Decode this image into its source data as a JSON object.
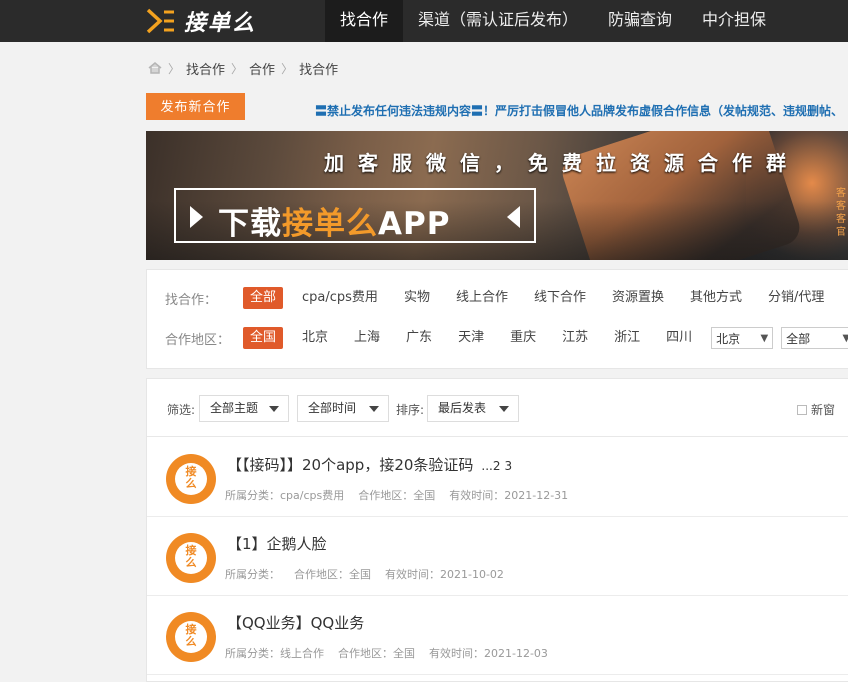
{
  "header": {
    "logo_text": "接单么",
    "nav": [
      "找合作",
      "渠道（需认证后发布）",
      "防骗查询",
      "中介担保"
    ]
  },
  "breadcrumb": [
    "找合作",
    "合作",
    "找合作"
  ],
  "publish_label": "发布新合作",
  "notice": "〓禁止发布任何违法违规内容〓！严厉打击假冒他人品牌发布虚假合作信息（发帖规范、违规删帖、",
  "banner": {
    "slogan": "加客服微信，免费拉资源合作群",
    "app_prefix": "下载",
    "app_highlight": "接单么",
    "app_suffix": "APP",
    "side": "客客客官"
  },
  "filters": {
    "type_label": "找合作：",
    "types": [
      "全部",
      "cpa/cps费用",
      "实物",
      "线上合作",
      "线下合作",
      "资源置换",
      "其他方式",
      "分销/代理"
    ],
    "region_label": "合作地区：",
    "regions": [
      "全国",
      "北京",
      "上海",
      "广东",
      "天津",
      "重庆",
      "江苏",
      "浙江",
      "四川"
    ],
    "region_select": "北京",
    "sub_select": "全部"
  },
  "toolbar": {
    "filter_label": "筛选:",
    "topic": "全部主题",
    "time": "全部时间",
    "sort_label": "排序:",
    "sort": "最后发表",
    "new_window": "新窗"
  },
  "posts": [
    {
      "title": "【【接码】】20个app，接20条验证码",
      "pages": [
        "...2",
        "3"
      ],
      "category": "所属分类：cpa/cps费用",
      "region": "合作地区：全国",
      "expires": "有效时间：2021-12-31"
    },
    {
      "title": "【1】企鹅人脸",
      "pages": [],
      "category": "所属分类：",
      "region": "合作地区：全国",
      "expires": "有效时间：2021-10-02"
    },
    {
      "title": "【QQ业务】QQ业务",
      "pages": [],
      "category": "所属分类：线上合作",
      "region": "合作地区：全国",
      "expires": "有效时间：2021-12-03"
    }
  ],
  "colors": {
    "topbar": "#2b2b2b",
    "accent": "#ef7d2d",
    "chip_active": "#e05a2a",
    "notice": "#1f6fb2"
  }
}
